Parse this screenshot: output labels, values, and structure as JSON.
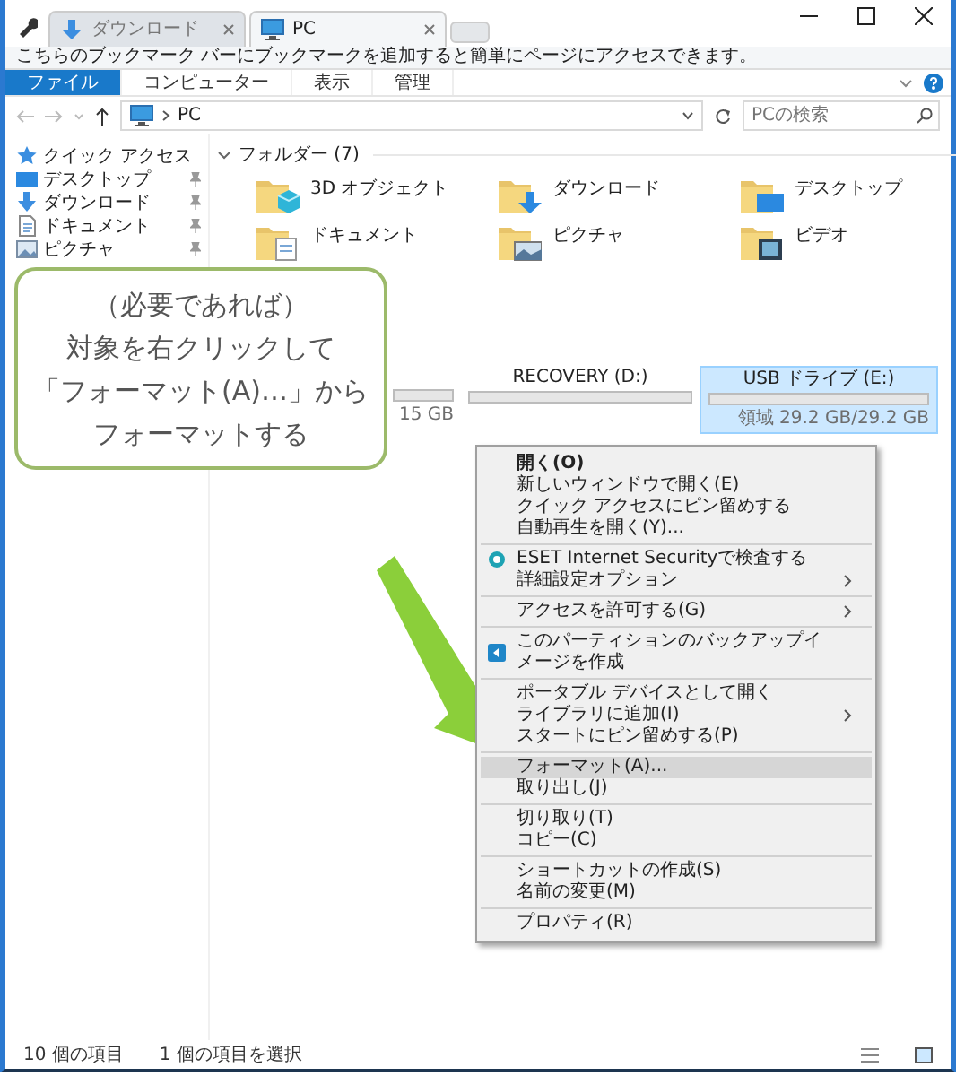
{
  "window": {
    "tabs": [
      {
        "label": "ダウンロード",
        "selected": false
      },
      {
        "label": "PC",
        "selected": true
      }
    ]
  },
  "bookmark_bar": {
    "text": "こちらのブックマーク バーにブックマークを追加すると簡単にページにアクセスできます。"
  },
  "ribbon": {
    "tabs": [
      {
        "label": "ファイル",
        "selected": true
      },
      {
        "label": "コンピューター",
        "selected": false
      },
      {
        "label": "表示",
        "selected": false
      },
      {
        "label": "管理",
        "selected": false
      }
    ]
  },
  "address_bar": {
    "path": "PC",
    "search_placeholder": "PCの検索"
  },
  "sidebar": {
    "items": [
      {
        "label": "クイック アクセス",
        "kind": "header"
      },
      {
        "label": "デスクトップ",
        "kind": "pinned"
      },
      {
        "label": "ダウンロード",
        "kind": "pinned"
      },
      {
        "label": "ドキュメント",
        "kind": "pinned"
      },
      {
        "label": "ピクチャ",
        "kind": "pinned"
      }
    ]
  },
  "folders": {
    "heading": "フォルダー (7)",
    "expanded": true,
    "items": [
      {
        "name": "3D オブジェクト"
      },
      {
        "name": "ダウンロード"
      },
      {
        "name": "デスクトップ"
      },
      {
        "name": "ドキュメント"
      },
      {
        "name": "ピクチャ"
      },
      {
        "name": "ビデオ"
      }
    ]
  },
  "drives": {
    "items": [
      {
        "free": "15 GB",
        "selected": false
      },
      {
        "label": "RECOVERY (D:)",
        "selected": false
      },
      {
        "label": "USB ドライブ (E:)",
        "free": "領域 29.2 GB/29.2 GB",
        "selected": true
      }
    ]
  },
  "context_menu": {
    "groups": [
      {
        "items": [
          {
            "label": "開く(O)",
            "kind": "text",
            "default": true,
            "submenu": false,
            "selected": false
          },
          {
            "label": "新しいウィンドウで開く(E)",
            "kind": "text",
            "default": false,
            "submenu": false,
            "selected": false
          },
          {
            "label": "クイック アクセスにピン留めする",
            "kind": "text",
            "default": false,
            "submenu": false,
            "selected": false
          },
          {
            "label": "自動再生を開く(Y)...",
            "kind": "text",
            "default": false,
            "submenu": false,
            "selected": false
          }
        ]
      },
      {
        "items": [
          {
            "label": "ESET Internet Securityで検査する",
            "kind": "eset",
            "default": false,
            "submenu": false,
            "selected": false
          },
          {
            "label": "詳細設定オプション",
            "kind": "text",
            "default": false,
            "submenu": true,
            "selected": false
          }
        ]
      },
      {
        "items": [
          {
            "label": "アクセスを許可する(G)",
            "kind": "text",
            "default": false,
            "submenu": true,
            "selected": false
          }
        ]
      },
      {
        "items": [
          {
            "label": "このパーティションのバックアップイメージを作成",
            "kind": "backup",
            "default": false,
            "submenu": false,
            "selected": false
          }
        ]
      },
      {
        "items": [
          {
            "label": "ポータブル デバイスとして開く",
            "kind": "text",
            "default": false,
            "submenu": false,
            "selected": false
          },
          {
            "label": "ライブラリに追加(I)",
            "kind": "text",
            "default": false,
            "submenu": true,
            "selected": false
          },
          {
            "label": "スタートにピン留めする(P)",
            "kind": "text",
            "default": false,
            "submenu": false,
            "selected": false
          }
        ]
      },
      {
        "items": [
          {
            "label": "フォーマット(A)...",
            "kind": "text",
            "default": false,
            "submenu": false,
            "selected": true
          },
          {
            "label": "取り出し(J)",
            "kind": "text",
            "default": false,
            "submenu": false,
            "selected": false
          }
        ]
      },
      {
        "items": [
          {
            "label": "切り取り(T)",
            "kind": "text",
            "default": false,
            "submenu": false,
            "selected": false
          },
          {
            "label": "コピー(C)",
            "kind": "text",
            "default": false,
            "submenu": false,
            "selected": false
          }
        ]
      },
      {
        "items": [
          {
            "label": "ショートカットの作成(S)",
            "kind": "text",
            "default": false,
            "submenu": false,
            "selected": false
          },
          {
            "label": "名前の変更(M)",
            "kind": "text",
            "default": false,
            "submenu": false,
            "selected": false
          }
        ]
      },
      {
        "items": [
          {
            "label": "プロパティ(R)",
            "kind": "text",
            "default": false,
            "submenu": false,
            "selected": false
          }
        ]
      }
    ]
  },
  "callout": {
    "lines": [
      "（必要であれば）",
      "対象を右クリックして",
      "「フォーマット(A)…」から",
      "フォーマットする"
    ]
  },
  "status_bar": {
    "items": [
      "10 個の項目",
      "1 個の項目を選択"
    ]
  }
}
